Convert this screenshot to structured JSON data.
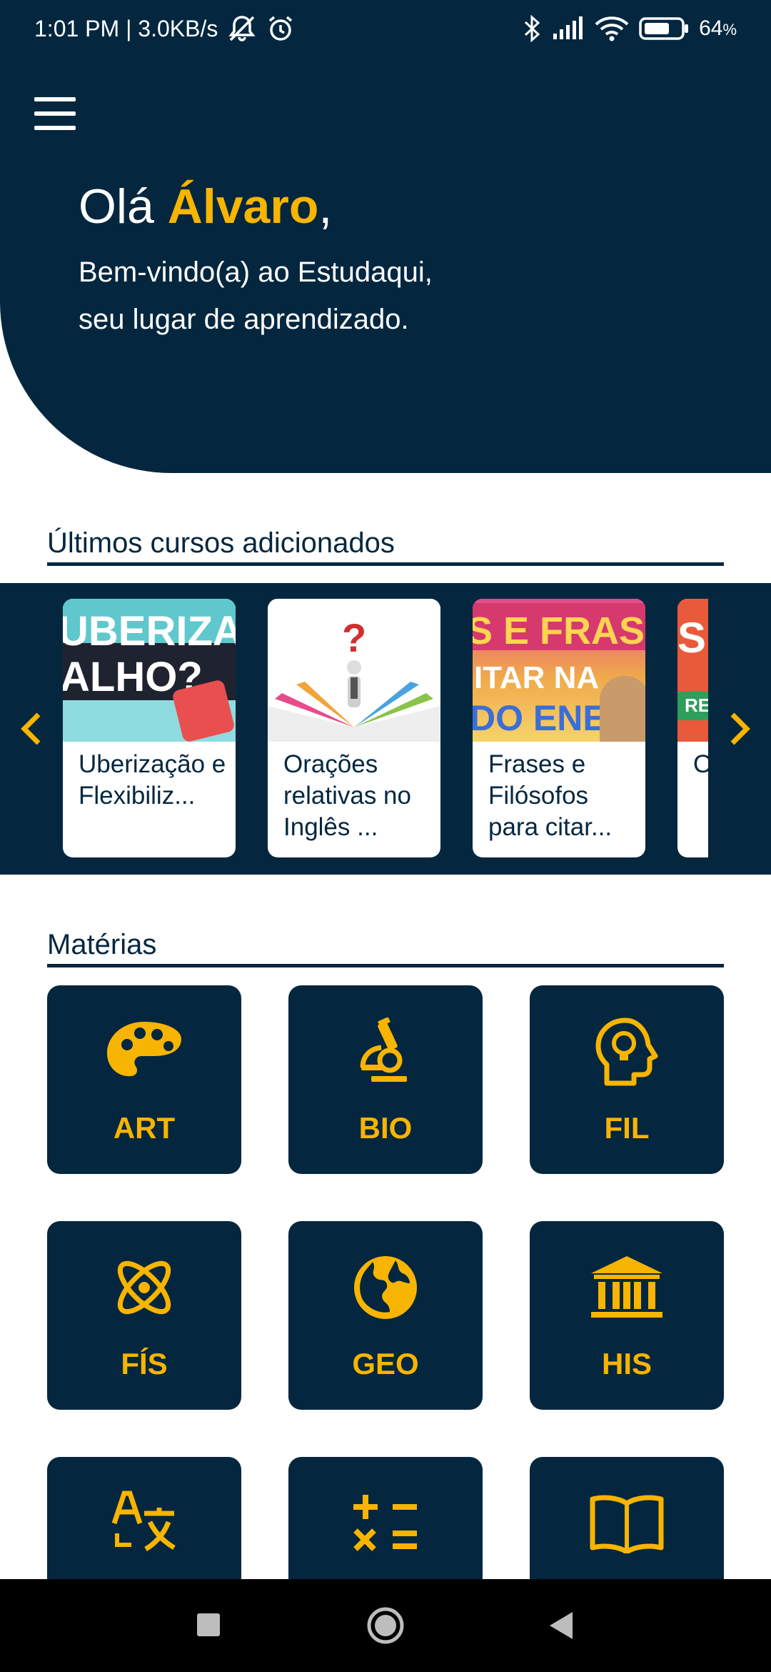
{
  "status_bar": {
    "time_speed": "1:01 PM | 3.0KB/s",
    "battery": "64",
    "battery_unit": "%",
    "icons": [
      "mute-icon",
      "alarm-icon",
      "bluetooth-icon",
      "signal-icon",
      "wifi-icon",
      "battery-icon"
    ]
  },
  "header": {
    "greeting_prefix": "Olá ",
    "user_name": "Álvaro",
    "greeting_suffix": ",",
    "welcome_line1": "Bem-vindo(a) ao Estudaqui,",
    "welcome_line2": "seu lugar de aprendizado."
  },
  "courses": {
    "title": "Últimos cursos adicionados",
    "items": [
      {
        "title": "Uberização e Flexibiliz...",
        "thumb_line1": "UBERIZAÇÃ",
        "thumb_line2": "ALHO?"
      },
      {
        "title": "Orações relativas no Inglês ...",
        "thumb_symbol": "?"
      },
      {
        "title": "Frases e Filósofos para citar...",
        "thumb_line1": "S E FRASES",
        "thumb_line2": "ITAR NA",
        "thumb_line3": "DO ENEM"
      },
      {
        "title": "O s m",
        "thumb_line1": "S",
        "thumb_line2": "RE"
      }
    ]
  },
  "subjects": {
    "title": "Matérias",
    "items": [
      {
        "label": "ART",
        "icon": "palette-icon"
      },
      {
        "label": "BIO",
        "icon": "microscope-icon"
      },
      {
        "label": "FIL",
        "icon": "head-bulb-icon"
      },
      {
        "label": "FÍS",
        "icon": "atom-icon"
      },
      {
        "label": "GEO",
        "icon": "globe-icon"
      },
      {
        "label": "HIS",
        "icon": "museum-icon"
      },
      {
        "label": "",
        "icon": "translate-icon"
      },
      {
        "label": "",
        "icon": "calculator-icon"
      },
      {
        "label": "",
        "icon": "book-icon"
      }
    ]
  },
  "colors": {
    "primary": "#04273f",
    "accent": "#f7b400",
    "background": "#ffffff"
  }
}
